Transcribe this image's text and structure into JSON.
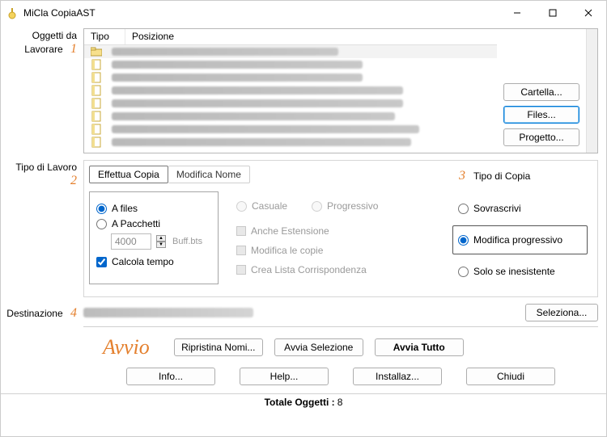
{
  "window": {
    "title": "MiCla CopiaAST"
  },
  "section1": {
    "label": "Oggetti da Lavorare",
    "num": "1",
    "columns": {
      "tipo": "Tipo",
      "posizione": "Posizione"
    },
    "buttons": {
      "cartella": "Cartella...",
      "files": "Files...",
      "progetto": "Progetto..."
    }
  },
  "section2": {
    "label": "Tipo di Lavoro",
    "num": "2",
    "tabs": {
      "copia": "Effettua Copia",
      "nome": "Modifica Nome"
    },
    "left": {
      "afiles": "A files",
      "apacchetti": "A Pacchetti",
      "buffval": "4000",
      "bufflabel": "Buff.bts",
      "calcola": "Calcola tempo"
    },
    "mid": {
      "casuale": "Casuale",
      "progressivo": "Progressivo",
      "anche": "Anche Estensione",
      "modcopie": "Modifica le copie",
      "crealist": "Crea Lista Corrispondenza"
    },
    "right": {
      "num": "3",
      "title": "Tipo di Copia",
      "sovrascrivi": "Sovrascrivi",
      "modprog": "Modifica progressivo",
      "solose": "Solo se inesistente"
    }
  },
  "section4": {
    "label": "Destinazione",
    "num": "4",
    "seleziona": "Seleziona..."
  },
  "avvio": {
    "word": "Avvio",
    "ripristina": "Ripristina Nomi...",
    "selez": "Avvia Selezione",
    "tutto": "Avvia Tutto"
  },
  "bottom": {
    "info": "Info...",
    "help": "Help...",
    "install": "Installaz...",
    "chiudi": "Chiudi"
  },
  "status": {
    "label": "Totale Oggetti :",
    "count": "8"
  }
}
